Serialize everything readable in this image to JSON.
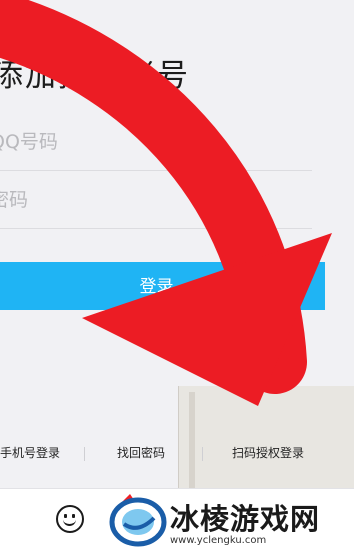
{
  "login": {
    "heading": "添加授权帐号",
    "account_placeholder": "QQ号码",
    "password_placeholder": "密码",
    "login_button": "登录"
  },
  "bottom_links": {
    "phone_login": "手机号登录",
    "forgot_password": "找回密码",
    "scan_authorize": "扫码授权登录"
  },
  "watermark": {
    "site_name": "冰棱游戏网",
    "site_url": "www.yclengku.com"
  },
  "colors": {
    "accent_button": "#1fb4f4",
    "annotation_arrow": "#ec1c24",
    "background": "#f1f1f4"
  },
  "icons": {
    "footer_left": "emoji-smile-icon",
    "annotation": "red-curved-arrow"
  }
}
